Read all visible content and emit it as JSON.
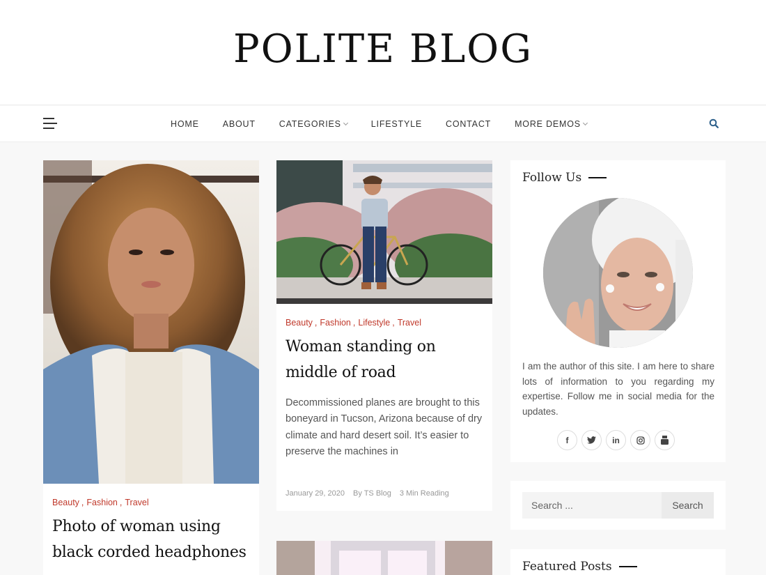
{
  "site": {
    "title": "POLITE BLOG"
  },
  "nav": {
    "items": [
      {
        "label": "HOME",
        "dropdown": false
      },
      {
        "label": "ABOUT",
        "dropdown": false
      },
      {
        "label": "CATEGORIES",
        "dropdown": true
      },
      {
        "label": "LIFESTYLE",
        "dropdown": false
      },
      {
        "label": "CONTACT",
        "dropdown": false
      },
      {
        "label": "MORE DEMOS",
        "dropdown": true
      }
    ],
    "menu_icon": "hamburger-icon",
    "search_icon": "search-icon",
    "accent_color": "#2c5f8a"
  },
  "posts": [
    {
      "image_alt": "Woman with curly hair wearing denim jacket",
      "categories": [
        "Beauty",
        "Fashion",
        "Travel"
      ],
      "title": "Photo of woman using black corded headphones"
    },
    {
      "image_alt": "Man standing with bicycle in front of flowers",
      "categories": [
        "Beauty",
        "Fashion",
        "Lifestyle",
        "Travel"
      ],
      "title": "Woman standing on middle of road",
      "excerpt": "Decommissioned planes are brought to this boneyard in Tucson, Arizona because of dry climate and hard desert soil. It’s easier to preserve the machines in",
      "date": "January 29, 2020",
      "author": "By TS Blog",
      "reading": "3 Min Reading"
    },
    {
      "image_alt": "Window with pink light"
    }
  ],
  "sidebar": {
    "follow": {
      "title": "Follow Us",
      "avatar_alt": "Woman with towel on head applying cream",
      "text": "I am the author of this site. I am here to share lots of information to you regarding my expertise. Follow me in social media for the updates.",
      "socials": [
        {
          "name": "facebook",
          "glyph": "f"
        },
        {
          "name": "twitter",
          "glyph": "t"
        },
        {
          "name": "linkedin",
          "glyph": "in"
        },
        {
          "name": "instagram",
          "glyph": "ig"
        },
        {
          "name": "youtube",
          "glyph": "yt"
        }
      ]
    },
    "search": {
      "placeholder": "Search ...",
      "button": "Search"
    },
    "featured": {
      "title": "Featured Posts"
    }
  },
  "colors": {
    "category": "#c0392b",
    "background": "#f8f8f8",
    "card": "#ffffff"
  }
}
